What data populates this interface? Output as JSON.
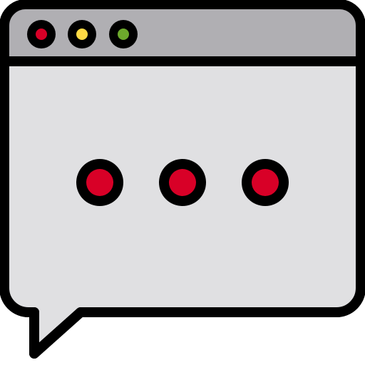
{
  "icon": {
    "name": "chat-window-typing-icon",
    "colors": {
      "outline": "#000000",
      "titlebar": "#B0AFB3",
      "body": "#E0E0E2",
      "close_dot": "#D80027",
      "minimize_dot": "#FFDA44",
      "maximize_dot": "#6DAA2C",
      "typing_dot": "#D80027"
    },
    "window_controls": [
      {
        "name": "close-dot-icon",
        "color_key": "close_dot"
      },
      {
        "name": "minimize-dot-icon",
        "color_key": "minimize_dot"
      },
      {
        "name": "maximize-dot-icon",
        "color_key": "maximize_dot"
      }
    ],
    "typing_indicator": {
      "dot_count": 3
    }
  }
}
